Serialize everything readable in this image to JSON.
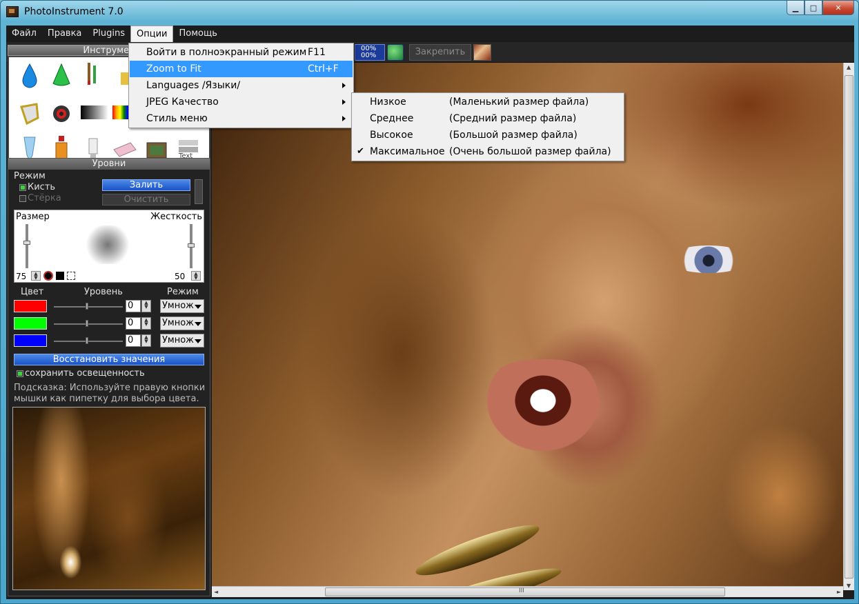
{
  "window": {
    "title": "PhotoInstrument 7.0",
    "minimize": "▁",
    "maximize": "□",
    "close": "✕"
  },
  "menubar": [
    "Файл",
    "Правка",
    "Plugins",
    "Опции",
    "Помощь"
  ],
  "toolbar": {
    "zoom_line1": "00%",
    "zoom_line2": "00%",
    "pin_label": "Закрепить"
  },
  "tools_panel": {
    "title": "Инструмен",
    "text_tool": "Text"
  },
  "options_menu": [
    {
      "label": "Войти в полноэкранный режим",
      "shortcut": "F11",
      "submenu": false
    },
    {
      "label": "Zoom to Fit",
      "shortcut": "Ctrl+F",
      "submenu": false,
      "highlighted": true
    },
    {
      "label": "Languages /Языки/",
      "shortcut": "",
      "submenu": true
    },
    {
      "label": "JPEG Качество",
      "shortcut": "",
      "submenu": true
    },
    {
      "label": "Стиль меню",
      "shortcut": "",
      "submenu": true
    }
  ],
  "jpeg_submenu": [
    {
      "label": "Низкое",
      "desc": "(Маленький размер файла)",
      "checked": false
    },
    {
      "label": "Среднее",
      "desc": "(Средний размер файла)",
      "checked": false
    },
    {
      "label": "Высокое",
      "desc": "(Большой размер файла)",
      "checked": false
    },
    {
      "label": "Максимальное",
      "desc": "(Очень большой размер файла)",
      "checked": true
    }
  ],
  "check_glyph": "✔",
  "levels": {
    "title": "Уровни",
    "mode_label": "Режим",
    "brush": "Кисть",
    "eraser": "Стёрка",
    "fill_btn": "Залить",
    "clear_btn": "Очистить",
    "size_label": "Размер",
    "hardness_label": "Жесткость",
    "size_value": "75",
    "hardness_value": "50",
    "col_color": "Цвет",
    "col_level": "Уровень",
    "col_mode": "Режим",
    "rows": [
      {
        "color": "#ff0000",
        "value": "0",
        "mode": "Умнож"
      },
      {
        "color": "#00ff00",
        "value": "0",
        "mode": "Умнож"
      },
      {
        "color": "#0000ff",
        "value": "0",
        "mode": "Умнож"
      }
    ],
    "restore_btn": "Восстановить значения",
    "keep_light": "сохранить освещенность",
    "hint_line1": "Подсказка: Используйте правую кнопки",
    "hint_line2": "мышки как пипетку для выбора цвета."
  },
  "scroll": {
    "grip": "III",
    "left": "◄",
    "right": "►",
    "up": "▲",
    "down": "▼"
  },
  "colors": {
    "highlight": "#3399ff",
    "panel_bg": "#222222",
    "menubar_bg": "#1c1c1c"
  }
}
